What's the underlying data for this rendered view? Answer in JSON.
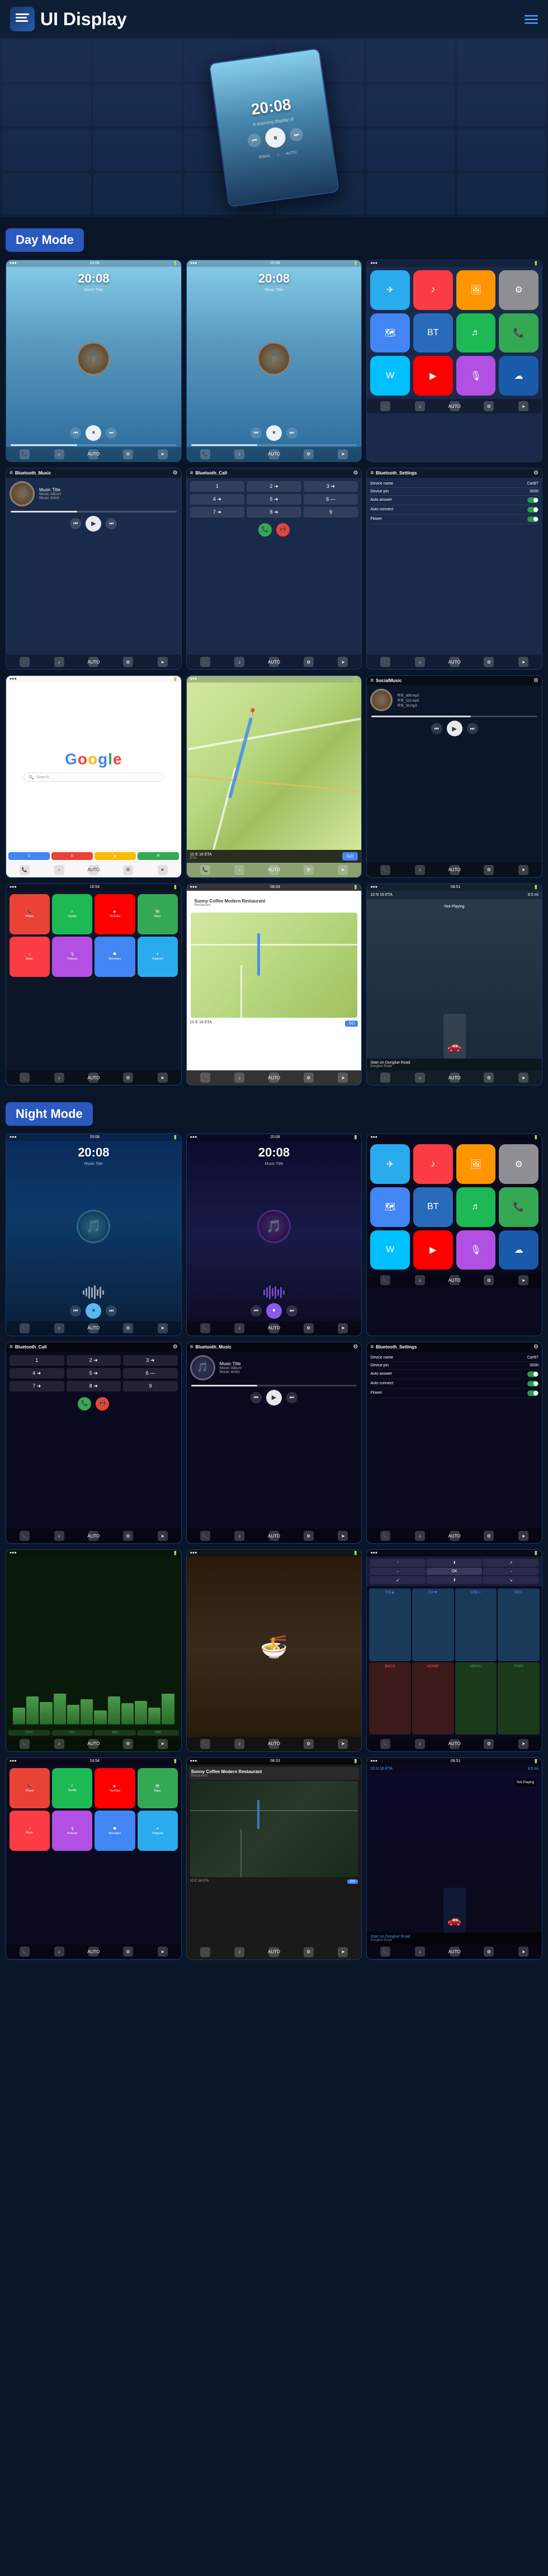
{
  "header": {
    "title": "UI Display",
    "menu_label": "☰",
    "nav_icon": "≡"
  },
  "day_mode": {
    "label": "Day Mode"
  },
  "night_mode": {
    "label": "Night Mode"
  },
  "screens": {
    "time1": "20:08",
    "time2": "20:08",
    "music_title": "Music Title",
    "music_album": "Music Album",
    "music_artist": "Music Artist",
    "device_name_label": "Device name",
    "device_name_value": "CarBT",
    "device_pin_label": "Device pin",
    "device_pin_value": "0000",
    "auto_answer_label": "Auto answer",
    "auto_connect_label": "Auto connect",
    "flower_label": "Flower",
    "bluetooth_music": "Bluetooth_Music",
    "bluetooth_call": "Bluetooth_Call",
    "bluetooth_settings": "Bluetooth_Settings",
    "google_text": "Google",
    "social_music": "SocialMusic",
    "sunny_coffee": "Sunny Coffee Modern Restaurant",
    "sunny_address": "10 E 16 ETA",
    "go_label": "GO",
    "map_eta": "10 E 16 ETA",
    "map_distance": "9.0 mi",
    "not_playing": "Not Playing",
    "start_on": "Start on Donglue Road",
    "map_road": "Donglue Road"
  },
  "icons": {
    "menu": "☰",
    "hamburger": "≡",
    "dots": "⋯",
    "play": "▶",
    "pause": "⏸",
    "prev": "⏮",
    "next": "⏭",
    "back": "⏪",
    "forward": "⏩",
    "phone": "📞",
    "music": "♪",
    "settings": "⚙",
    "home": "⌂",
    "search": "🔍",
    "nav": "➤"
  },
  "app_colors": {
    "phone": "#34a853",
    "music": "#fc3c44",
    "maps": "#4285f4",
    "settings": "#8e8e93",
    "telegram": "#2aabee",
    "bt": "#2a6abb",
    "photos": "#ff9500",
    "waze": "#00c0ff",
    "spotify": "#1db954",
    "youtube": "#ff0000",
    "podcast": "#b150e2"
  }
}
